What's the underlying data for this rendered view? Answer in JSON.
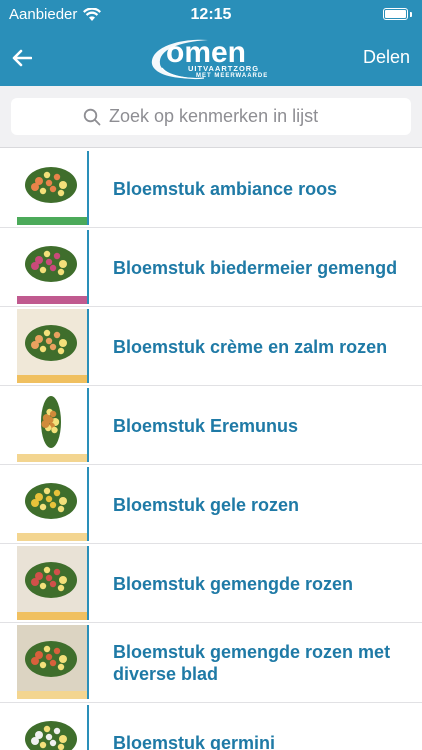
{
  "status": {
    "carrier": "Aanbieder",
    "time": "12:15",
    "battery_level": 1.0
  },
  "nav": {
    "back_icon": "back-arrow-icon",
    "logo_word": "omen",
    "logo_line1": "UITVAARTZORG",
    "logo_line2": "MET MEERWAARDE",
    "share_label": "Delen"
  },
  "search": {
    "placeholder": "Zoek op kenmerken in lijst",
    "value": ""
  },
  "items": [
    {
      "label": "Bloemstuk ambiance roos",
      "bg": "#ffffff",
      "accent": "#e8834a",
      "foot": "#4caa5a"
    },
    {
      "label": "Bloemstuk biedermeier gemengd",
      "bg": "#ffffff",
      "accent": "#c94a7a",
      "foot": "#c05a8f"
    },
    {
      "label": "Bloemstuk crème en zalm rozen",
      "bg": "#f0e8d8",
      "accent": "#e9a15f",
      "foot": "#f0c060"
    },
    {
      "label": "Bloemstuk Eremunus",
      "bg": "#ffffff",
      "accent": "#d08a3a",
      "foot": "#f3d590"
    },
    {
      "label": "Bloemstuk gele rozen",
      "bg": "#ffffff",
      "accent": "#e8c23a",
      "foot": "#f3d590"
    },
    {
      "label": "Bloemstuk gemengde rozen",
      "bg": "#e9e2d6",
      "accent": "#d2504a",
      "foot": "#f0c060"
    },
    {
      "label": "Bloemstuk gemengde rozen met diverse blad",
      "bg": "#dcd4c2",
      "accent": "#d8603c",
      "foot": "#f3d590"
    },
    {
      "label": "Bloemstuk germini",
      "bg": "#ffffff",
      "accent": "#f0f0f0",
      "foot": "#ffffff"
    }
  ]
}
